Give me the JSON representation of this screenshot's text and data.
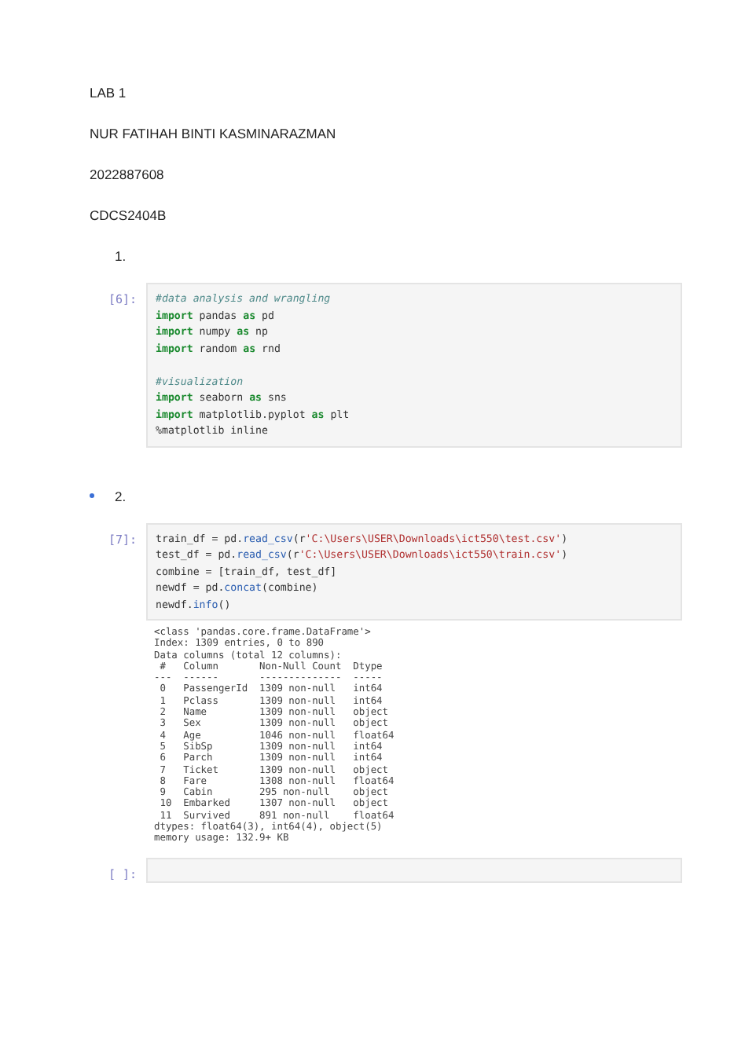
{
  "header": [
    "LAB 1",
    "NUR FATIHAH BINTI KASMINARAZMAN",
    "2022887608",
    "CDCS2404B"
  ],
  "sections": [
    {
      "number": "1.",
      "cells": [
        {
          "prompt": "[6]:",
          "blocks": [
            [
              [
                {
                  "text": "#data analysis and wrangling",
                  "kind": "comment"
                }
              ],
              [
                {
                  "text": "import",
                  "kind": "keyword"
                },
                {
                  "text": " pandas ",
                  "kind": "plain"
                },
                {
                  "text": "as",
                  "kind": "keyword"
                },
                {
                  "text": " pd",
                  "kind": "plain"
                }
              ],
              [
                {
                  "text": "import",
                  "kind": "keyword"
                },
                {
                  "text": " numpy ",
                  "kind": "plain"
                },
                {
                  "text": "as",
                  "kind": "keyword"
                },
                {
                  "text": " np",
                  "kind": "plain"
                }
              ],
              [
                {
                  "text": "import",
                  "kind": "keyword"
                },
                {
                  "text": " random ",
                  "kind": "plain"
                },
                {
                  "text": "as",
                  "kind": "keyword"
                },
                {
                  "text": " rnd",
                  "kind": "plain"
                }
              ]
            ],
            [
              [
                {
                  "text": "#visualization",
                  "kind": "comment"
                }
              ],
              [
                {
                  "text": "import",
                  "kind": "keyword"
                },
                {
                  "text": " seaborn ",
                  "kind": "plain"
                },
                {
                  "text": "as",
                  "kind": "keyword"
                },
                {
                  "text": " sns",
                  "kind": "plain"
                }
              ],
              [
                {
                  "text": "import",
                  "kind": "keyword"
                },
                {
                  "text": " matplotlib.pyplot ",
                  "kind": "plain"
                },
                {
                  "text": "as",
                  "kind": "keyword"
                },
                {
                  "text": " plt",
                  "kind": "plain"
                }
              ],
              [
                {
                  "text": "%matplotlib inline",
                  "kind": "plain"
                }
              ]
            ]
          ]
        }
      ]
    },
    {
      "number": "2.",
      "cells": [
        {
          "prompt": "[7]:",
          "blocks": [
            [
              [
                {
                  "text": "train_df = pd.",
                  "kind": "plain"
                },
                {
                  "text": "read_csv",
                  "kind": "func"
                },
                {
                  "text": "(r",
                  "kind": "plain"
                },
                {
                  "text": "'C:\\Users\\USER\\Downloads\\ict550\\test.csv'",
                  "kind": "string"
                },
                {
                  "text": ")",
                  "kind": "plain"
                }
              ],
              [
                {
                  "text": "test_df = pd.",
                  "kind": "plain"
                },
                {
                  "text": "read_csv",
                  "kind": "func"
                },
                {
                  "text": "(r",
                  "kind": "plain"
                },
                {
                  "text": "'C:\\Users\\USER\\Downloads\\ict550\\train.csv'",
                  "kind": "string"
                },
                {
                  "text": ")",
                  "kind": "plain"
                }
              ],
              [
                {
                  "text": "combine = [train_df, test_df]",
                  "kind": "plain"
                }
              ],
              [
                {
                  "text": "newdf = pd.",
                  "kind": "plain"
                },
                {
                  "text": "concat",
                  "kind": "func"
                },
                {
                  "text": "(combine)",
                  "kind": "plain"
                }
              ],
              [
                {
                  "text": "newdf.",
                  "kind": "plain"
                },
                {
                  "text": "info",
                  "kind": "func"
                },
                {
                  "text": "()",
                  "kind": "plain"
                }
              ]
            ]
          ],
          "output": [
            "<class 'pandas.core.frame.DataFrame'>",
            "Index: 1309 entries, 0 to 890",
            "Data columns (total 12 columns):",
            " #   Column       Non-Null Count  Dtype",
            "---  ------       --------------  -----",
            " 0   PassengerId  1309 non-null   int64",
            " 1   Pclass       1309 non-null   int64",
            " 2   Name         1309 non-null   object",
            " 3   Sex          1309 non-null   object",
            " 4   Age          1046 non-null   float64",
            " 5   SibSp        1309 non-null   int64",
            " 6   Parch        1309 non-null   int64",
            " 7   Ticket       1309 non-null   object",
            " 8   Fare         1308 non-null   float64",
            " 9   Cabin        295 non-null    object",
            " 10  Embarked     1307 non-null   object",
            " 11  Survived     891 non-null    float64",
            "dtypes: float64(3), int64(4), object(5)",
            "memory usage: 132.9+ KB"
          ]
        },
        {
          "prompt": "[ ]:"
        }
      ]
    }
  ]
}
